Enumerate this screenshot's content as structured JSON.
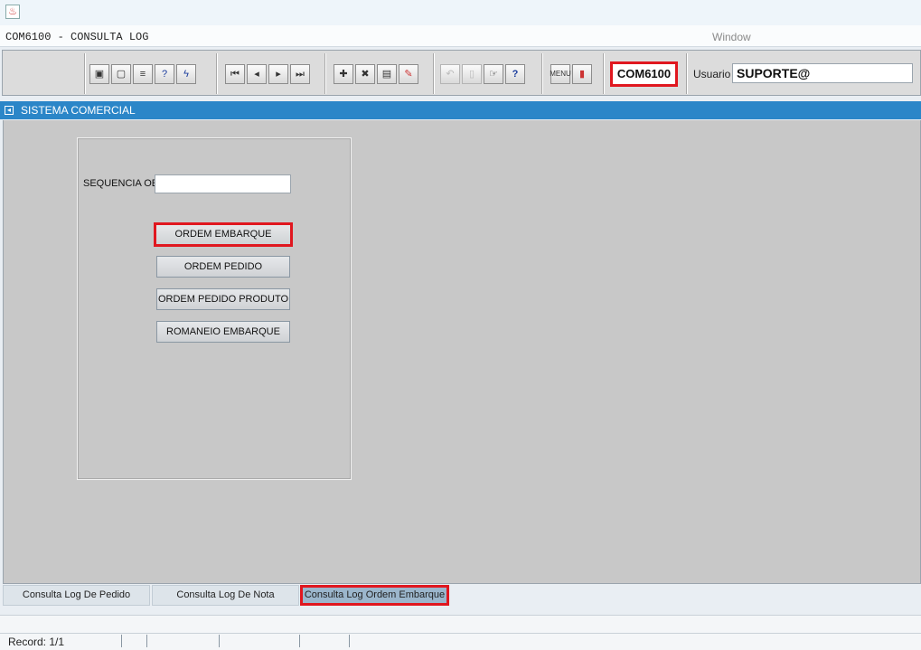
{
  "titlebar": {
    "icon": "java-cup-icon"
  },
  "menu": {
    "title": "COM6100 - CONSULTA LOG",
    "window": "Window"
  },
  "toolbar": {
    "form_code": "COM6100",
    "usuario_label": "Usuario",
    "usuario_value": "SUPORTE@",
    "groups": [
      [
        "save-icon",
        "window-icon",
        "print-icon",
        "query-help-icon",
        "execute-icon"
      ],
      [
        "first-record-icon",
        "previous-record-icon",
        "next-record-icon",
        "last-record-icon"
      ],
      [
        "insert-record-icon",
        "delete-record-icon",
        "lov-icon",
        "edit-icon"
      ],
      [
        "undo-icon",
        "clipboard-icon",
        "tools-icon",
        "help-icon"
      ],
      [
        "menu-icon",
        "exit-icon"
      ]
    ]
  },
  "window": {
    "title": "SISTEMA COMERCIAL"
  },
  "form": {
    "sequencia_label": "SEQUENCIA OE",
    "sequencia_value": "",
    "buttons": {
      "ordem_embarque": "ORDEM EMBARQUE",
      "ordem_pedido": "ORDEM PEDIDO",
      "ordem_pedido_produto": "ORDEM PEDIDO PRODUTO",
      "romaneio_embarque": "ROMANEIO EMBARQUE"
    }
  },
  "tabs": [
    {
      "label": "Consulta Log De Pedido",
      "active": false
    },
    {
      "label": "Consulta Log De Nota",
      "active": false
    },
    {
      "label": "Consulta Log Ordem Embarque",
      "active": true
    }
  ],
  "status": {
    "record": "Record: 1/1"
  },
  "colors": {
    "highlight": "#e0171f",
    "header_blue": "#2b86c8",
    "canvas": "#c8c8c8"
  }
}
